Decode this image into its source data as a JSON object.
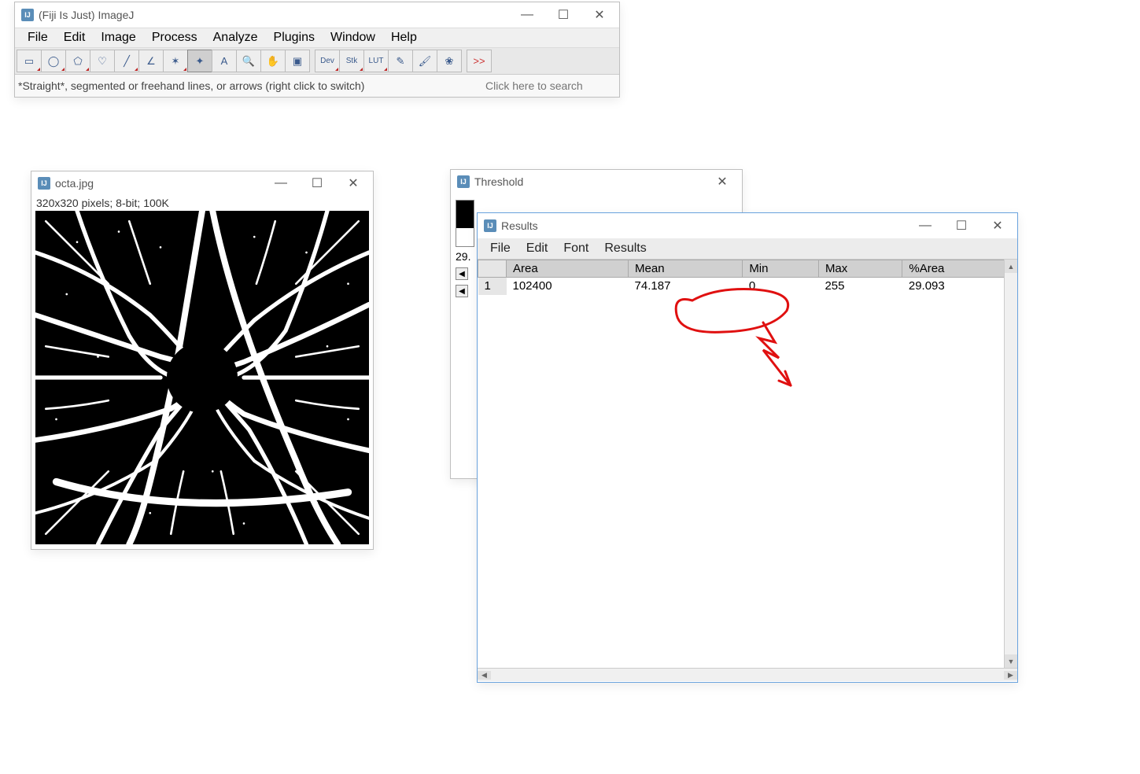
{
  "fiji": {
    "title": "(Fiji Is Just) ImageJ",
    "menu": [
      "File",
      "Edit",
      "Image",
      "Process",
      "Analyze",
      "Plugins",
      "Window",
      "Help"
    ],
    "tools": [
      {
        "name": "rectangle-tool",
        "glyph": "▭",
        "corner": true
      },
      {
        "name": "oval-tool",
        "glyph": "◯",
        "corner": true
      },
      {
        "name": "polygon-tool",
        "glyph": "⬠",
        "corner": true
      },
      {
        "name": "freehand-tool",
        "glyph": "♡",
        "corner": false
      },
      {
        "name": "line-tool",
        "glyph": "╱",
        "corner": true
      },
      {
        "name": "angle-tool",
        "glyph": "∠",
        "corner": false
      },
      {
        "name": "point-tool",
        "glyph": "✶",
        "corner": true
      },
      {
        "name": "wand-tool",
        "glyph": "✦",
        "corner": false,
        "selected": true
      },
      {
        "name": "text-tool",
        "glyph": "A",
        "corner": false
      },
      {
        "name": "magnify-tool",
        "glyph": "🔍",
        "corner": false
      },
      {
        "name": "hand-tool",
        "glyph": "✋",
        "corner": false
      },
      {
        "name": "color-picker-tool",
        "glyph": "▣",
        "corner": false
      }
    ],
    "extraTools": [
      {
        "name": "dev-tool",
        "label": "Dev",
        "corner": true
      },
      {
        "name": "stk-tool",
        "label": "Stk",
        "corner": true
      },
      {
        "name": "lut-tool",
        "label": "LUT",
        "corner": true
      },
      {
        "name": "pencil-tool",
        "glyph": "✎"
      },
      {
        "name": "brush-tool",
        "glyph": "🖌"
      },
      {
        "name": "spray-tool",
        "glyph": "❀"
      }
    ],
    "moreGlyph": ">>",
    "status": "*Straight*, segmented or freehand lines, or arrows (right click to switch)",
    "searchPlaceholder": "Click here to search"
  },
  "imageWindow": {
    "title": "octa.jpg",
    "info": "320x320 pixels; 8-bit; 100K"
  },
  "thresholdWindow": {
    "title": "Threshold",
    "partialValue": "29."
  },
  "resultsWindow": {
    "title": "Results",
    "menu": [
      "File",
      "Edit",
      "Font",
      "Results"
    ],
    "headers": [
      "",
      "Area",
      "Mean",
      "Min",
      "Max",
      "%Area"
    ],
    "rows": [
      {
        "idx": "1",
        "Area": "102400",
        "Mean": "74.187",
        "Min": "0",
        "Max": "255",
        "PctArea": "29.093"
      }
    ]
  }
}
